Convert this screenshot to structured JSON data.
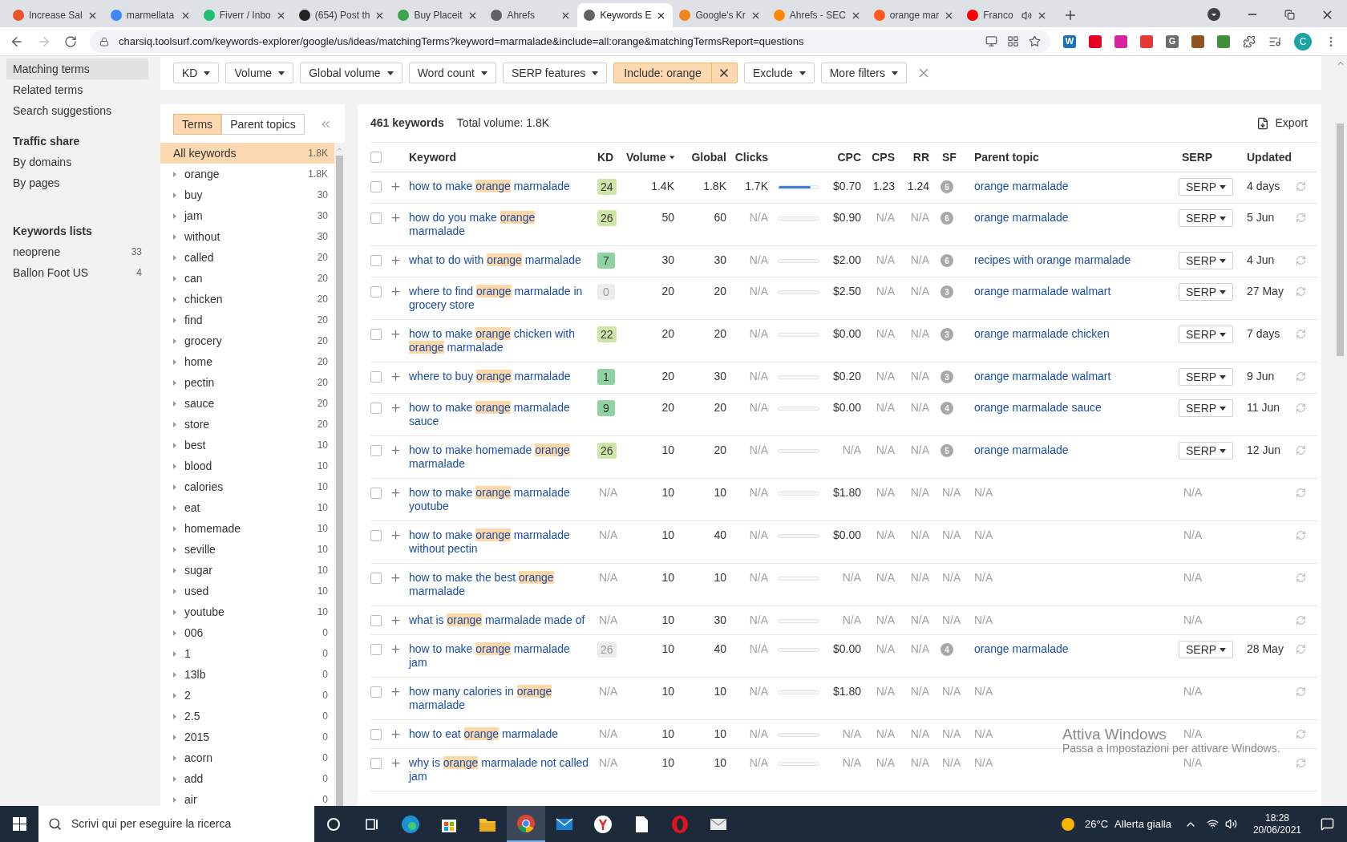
{
  "browser": {
    "tabs": [
      {
        "title": "Increase Sal",
        "color": "#e8542a",
        "selected": false,
        "audio": false
      },
      {
        "title": "marmellata",
        "color": "#4285f4",
        "selected": false,
        "audio": false
      },
      {
        "title": "Fiverr / Inbo",
        "color": "#1dbf73",
        "selected": false,
        "audio": false
      },
      {
        "title": "(654) Post th",
        "color": "#222222",
        "selected": false,
        "audio": false
      },
      {
        "title": "Buy Placeit",
        "color": "#3ca34a",
        "selected": false,
        "audio": false
      },
      {
        "title": "Ahrefs",
        "color": "#5f6368",
        "selected": false,
        "audio": false
      },
      {
        "title": "Keywords E",
        "color": "#5f6368",
        "selected": true,
        "audio": false
      },
      {
        "title": "Google's Kr",
        "color": "#f58220",
        "selected": false,
        "audio": false
      },
      {
        "title": "Ahrefs - SEC",
        "color": "#ff8800",
        "selected": false,
        "audio": false
      },
      {
        "title": "orange mar",
        "color": "#ff5a1f",
        "selected": false,
        "audio": false
      },
      {
        "title": "Franco",
        "color": "#ff0000",
        "selected": false,
        "audio": true
      }
    ],
    "url": "charsiq.toolsurf.com/keywords-explorer/google/us/ideas/matchingTerms?keyword=marmalade&include=all:orange&matchingTermsReport=questions",
    "extensions": [
      {
        "label": "W",
        "color": "#1d6fb8"
      },
      {
        "color": "#e60023"
      },
      {
        "color": "#d6249f"
      },
      {
        "color": "#e53935"
      },
      {
        "label": "G",
        "color": "#6b6b6b"
      },
      {
        "color": "#8d5524"
      },
      {
        "color": "#3f8f3f"
      }
    ],
    "profile": {
      "initial": "C",
      "color": "#1ca3a3"
    }
  },
  "sidebar": {
    "sections": [
      {
        "items": [
          {
            "label": "Matching terms",
            "selected": true
          },
          {
            "label": "Related terms",
            "selected": false
          },
          {
            "label": "Search suggestions",
            "selected": false
          }
        ]
      },
      {
        "heading": "Traffic share",
        "items": [
          {
            "label": "By domains",
            "selected": false
          },
          {
            "label": "By pages",
            "selected": false
          }
        ]
      },
      {
        "heading": "Keywords lists",
        "items": [
          {
            "label": "neoprene",
            "count": "33",
            "selected": false
          },
          {
            "label": "Ballon Foot US",
            "count": "4",
            "selected": false
          }
        ]
      }
    ]
  },
  "filters": [
    {
      "label": "KD",
      "active": false
    },
    {
      "label": "Volume",
      "active": false
    },
    {
      "label": "Global volume",
      "active": false
    },
    {
      "label": "Word count",
      "active": false
    },
    {
      "label": "SERP features",
      "active": false
    },
    {
      "label": "Include: orange",
      "active": true
    },
    {
      "label": "Exclude",
      "active": false
    },
    {
      "label": "More filters",
      "active": false
    }
  ],
  "terms_panel": {
    "tabs": [
      {
        "label": "Terms",
        "selected": true
      },
      {
        "label": "Parent topics",
        "selected": false
      }
    ],
    "items": [
      {
        "label": "All keywords",
        "count": "1.8K",
        "selected": true,
        "expandable": false
      },
      {
        "label": "orange",
        "count": "1.8K",
        "selected": false,
        "expandable": true
      },
      {
        "label": "buy",
        "count": "30",
        "selected": false,
        "expandable": true
      },
      {
        "label": "jam",
        "count": "30",
        "selected": false,
        "expandable": true
      },
      {
        "label": "without",
        "count": "30",
        "selected": false,
        "expandable": true
      },
      {
        "label": "called",
        "count": "20",
        "selected": false,
        "expandable": true
      },
      {
        "label": "can",
        "count": "20",
        "selected": false,
        "expandable": true
      },
      {
        "label": "chicken",
        "count": "20",
        "selected": false,
        "expandable": true
      },
      {
        "label": "find",
        "count": "20",
        "selected": false,
        "expandable": true
      },
      {
        "label": "grocery",
        "count": "20",
        "selected": false,
        "expandable": true
      },
      {
        "label": "home",
        "count": "20",
        "selected": false,
        "expandable": true
      },
      {
        "label": "pectin",
        "count": "20",
        "selected": false,
        "expandable": true
      },
      {
        "label": "sauce",
        "count": "20",
        "selected": false,
        "expandable": true
      },
      {
        "label": "store",
        "count": "20",
        "selected": false,
        "expandable": true
      },
      {
        "label": "best",
        "count": "10",
        "selected": false,
        "expandable": true
      },
      {
        "label": "blood",
        "count": "10",
        "selected": false,
        "expandable": true
      },
      {
        "label": "calories",
        "count": "10",
        "selected": false,
        "expandable": true
      },
      {
        "label": "eat",
        "count": "10",
        "selected": false,
        "expandable": true
      },
      {
        "label": "homemade",
        "count": "10",
        "selected": false,
        "expandable": true
      },
      {
        "label": "seville",
        "count": "10",
        "selected": false,
        "expandable": true
      },
      {
        "label": "sugar",
        "count": "10",
        "selected": false,
        "expandable": true
      },
      {
        "label": "used",
        "count": "10",
        "selected": false,
        "expandable": true
      },
      {
        "label": "youtube",
        "count": "10",
        "selected": false,
        "expandable": true
      },
      {
        "label": "006",
        "count": "0",
        "selected": false,
        "expandable": true
      },
      {
        "label": "1",
        "count": "0",
        "selected": false,
        "expandable": true
      },
      {
        "label": "13lb",
        "count": "0",
        "selected": false,
        "expandable": true
      },
      {
        "label": "2",
        "count": "0",
        "selected": false,
        "expandable": true
      },
      {
        "label": "2.5",
        "count": "0",
        "selected": false,
        "expandable": true
      },
      {
        "label": "2015",
        "count": "0",
        "selected": false,
        "expandable": true
      },
      {
        "label": "acorn",
        "count": "0",
        "selected": false,
        "expandable": true
      },
      {
        "label": "add",
        "count": "0",
        "selected": false,
        "expandable": true
      },
      {
        "label": "air",
        "count": "0",
        "selected": false,
        "expandable": true
      }
    ]
  },
  "results": {
    "count": "461 keywords",
    "total_volume": "Total volume: 1.8K",
    "export": "Export",
    "columns": [
      "Keyword",
      "KD",
      "Volume",
      "Global",
      "Clicks",
      "CPC",
      "CPS",
      "RR",
      "SF",
      "Parent topic",
      "SERP",
      "Updated"
    ],
    "select_all_checked": false,
    "rows": [
      {
        "checked": false,
        "keyword": [
          {
            "text": "how to make ",
            "highlight": false
          },
          {
            "text": "orange",
            "highlight": true
          },
          {
            "text": " marmalade",
            "highlight": false
          }
        ],
        "kd": {
          "text": "24",
          "kind": "score",
          "color": "#cfe5a8"
        },
        "volume": "1.4K",
        "global": "1.8K",
        "clicks": {
          "text": "1.7K",
          "muted": false
        },
        "level": 0.8,
        "cpc": {
          "text": "$0.70",
          "muted": false
        },
        "cps": {
          "text": "1.23",
          "muted": false
        },
        "rr": {
          "text": "1.24",
          "muted": false
        },
        "sf": {
          "text": "5",
          "kind": "count"
        },
        "parent": {
          "text": "orange marmalade",
          "kind": "link"
        },
        "serp": {
          "text": "SERP",
          "kind": "button"
        },
        "updated": "4 days"
      },
      {
        "checked": false,
        "keyword": [
          {
            "text": "how do you make ",
            "highlight": false
          },
          {
            "text": "orange",
            "highlight": true
          },
          {
            "text": " marmalade",
            "highlight": false
          }
        ],
        "kd": {
          "text": "26",
          "kind": "score",
          "color": "#cfe5a8"
        },
        "volume": "50",
        "global": "60",
        "clicks": {
          "text": "N/A",
          "muted": true
        },
        "level": 0,
        "cpc": {
          "text": "$0.90",
          "muted": false
        },
        "cps": {
          "text": "N/A",
          "muted": true
        },
        "rr": {
          "text": "N/A",
          "muted": true
        },
        "sf": {
          "text": "6",
          "kind": "count"
        },
        "parent": {
          "text": "orange marmalade",
          "kind": "link"
        },
        "serp": {
          "text": "SERP",
          "kind": "button"
        },
        "updated": "5 Jun"
      },
      {
        "checked": false,
        "keyword": [
          {
            "text": "what to do with ",
            "highlight": false
          },
          {
            "text": "orange",
            "highlight": true
          },
          {
            "text": " marmalade",
            "highlight": false
          }
        ],
        "kd": {
          "text": "7",
          "kind": "score",
          "color": "#8fd3a3"
        },
        "volume": "30",
        "global": "30",
        "clicks": {
          "text": "N/A",
          "muted": true
        },
        "level": 0,
        "cpc": {
          "text": "$2.00",
          "muted": false
        },
        "cps": {
          "text": "N/A",
          "muted": true
        },
        "rr": {
          "text": "N/A",
          "muted": true
        },
        "sf": {
          "text": "6",
          "kind": "count"
        },
        "parent": {
          "text": "recipes with orange marmalade",
          "kind": "link"
        },
        "serp": {
          "text": "SERP",
          "kind": "button"
        },
        "updated": "4 Jun"
      },
      {
        "checked": false,
        "keyword": [
          {
            "text": "where to find ",
            "highlight": false
          },
          {
            "text": "orange",
            "highlight": true
          },
          {
            "text": " marmalade in grocery store",
            "highlight": false
          }
        ],
        "kd": {
          "text": "0",
          "kind": "stale",
          "color": "#ececec"
        },
        "volume": "20",
        "global": "20",
        "clicks": {
          "text": "N/A",
          "muted": true
        },
        "level": 0,
        "cpc": {
          "text": "$2.50",
          "muted": false
        },
        "cps": {
          "text": "N/A",
          "muted": true
        },
        "rr": {
          "text": "N/A",
          "muted": true
        },
        "sf": {
          "text": "3",
          "kind": "count"
        },
        "parent": {
          "text": "orange marmalade walmart",
          "kind": "link"
        },
        "serp": {
          "text": "SERP",
          "kind": "button"
        },
        "updated": "27 May"
      },
      {
        "checked": false,
        "keyword": [
          {
            "text": "how to make ",
            "highlight": false
          },
          {
            "text": "orange",
            "highlight": true
          },
          {
            "text": " chicken with ",
            "highlight": false
          },
          {
            "text": "orange",
            "highlight": true
          },
          {
            "text": " marmalade",
            "highlight": false
          }
        ],
        "kd": {
          "text": "22",
          "kind": "score",
          "color": "#cfe5a8"
        },
        "volume": "20",
        "global": "20",
        "clicks": {
          "text": "N/A",
          "muted": true
        },
        "level": 0,
        "cpc": {
          "text": "$0.00",
          "muted": false
        },
        "cps": {
          "text": "N/A",
          "muted": true
        },
        "rr": {
          "text": "N/A",
          "muted": true
        },
        "sf": {
          "text": "3",
          "kind": "count"
        },
        "parent": {
          "text": "orange marmalade chicken",
          "kind": "link"
        },
        "serp": {
          "text": "SERP",
          "kind": "button"
        },
        "updated": "7 days"
      },
      {
        "checked": false,
        "keyword": [
          {
            "text": "where to buy ",
            "highlight": false
          },
          {
            "text": "orange",
            "highlight": true
          },
          {
            "text": " marmalade",
            "highlight": false
          }
        ],
        "kd": {
          "text": "1",
          "kind": "score",
          "color": "#8fd3a3"
        },
        "volume": "20",
        "global": "30",
        "clicks": {
          "text": "N/A",
          "muted": true
        },
        "level": 0,
        "cpc": {
          "text": "$0.20",
          "muted": false
        },
        "cps": {
          "text": "N/A",
          "muted": true
        },
        "rr": {
          "text": "N/A",
          "muted": true
        },
        "sf": {
          "text": "3",
          "kind": "count"
        },
        "parent": {
          "text": "orange marmalade walmart",
          "kind": "link"
        },
        "serp": {
          "text": "SERP",
          "kind": "button"
        },
        "updated": "9 Jun"
      },
      {
        "checked": false,
        "keyword": [
          {
            "text": "how to make ",
            "highlight": false
          },
          {
            "text": "orange",
            "highlight": true
          },
          {
            "text": " marmalade sauce",
            "highlight": false
          }
        ],
        "kd": {
          "text": "9",
          "kind": "score",
          "color": "#8fd3a3"
        },
        "volume": "20",
        "global": "20",
        "clicks": {
          "text": "N/A",
          "muted": true
        },
        "level": 0,
        "cpc": {
          "text": "$0.00",
          "muted": false
        },
        "cps": {
          "text": "N/A",
          "muted": true
        },
        "rr": {
          "text": "N/A",
          "muted": true
        },
        "sf": {
          "text": "4",
          "kind": "count"
        },
        "parent": {
          "text": "orange marmalade sauce",
          "kind": "link"
        },
        "serp": {
          "text": "SERP",
          "kind": "button"
        },
        "updated": "11 Jun"
      },
      {
        "checked": false,
        "keyword": [
          {
            "text": "how to make homemade ",
            "highlight": false
          },
          {
            "text": "orange",
            "highlight": true
          },
          {
            "text": " marmalade",
            "highlight": false
          }
        ],
        "kd": {
          "text": "26",
          "kind": "score",
          "color": "#cfe5a8"
        },
        "volume": "10",
        "global": "20",
        "clicks": {
          "text": "N/A",
          "muted": true
        },
        "level": 0,
        "cpc": {
          "text": "N/A",
          "muted": true
        },
        "cps": {
          "text": "N/A",
          "muted": true
        },
        "rr": {
          "text": "N/A",
          "muted": true
        },
        "sf": {
          "text": "5",
          "kind": "count"
        },
        "parent": {
          "text": "orange marmalade",
          "kind": "link"
        },
        "serp": {
          "text": "SERP",
          "kind": "button"
        },
        "updated": "12 Jun"
      },
      {
        "checked": false,
        "keyword": [
          {
            "text": "how to make ",
            "highlight": false
          },
          {
            "text": "orange",
            "highlight": true
          },
          {
            "text": " marmalade youtube",
            "highlight": false
          }
        ],
        "kd": {
          "text": "N/A",
          "kind": "none"
        },
        "volume": "10",
        "global": "10",
        "clicks": {
          "text": "N/A",
          "muted": true
        },
        "level": 0,
        "cpc": {
          "text": "$1.80",
          "muted": false
        },
        "cps": {
          "text": "N/A",
          "muted": true
        },
        "rr": {
          "text": "N/A",
          "muted": true
        },
        "sf": {
          "text": "N/A",
          "kind": "none"
        },
        "parent": {
          "text": "N/A",
          "kind": "none"
        },
        "serp": {
          "text": "N/A",
          "kind": "none"
        }
      },
      {
        "checked": false,
        "keyword": [
          {
            "text": "how to make ",
            "highlight": false
          },
          {
            "text": "orange",
            "highlight": true
          },
          {
            "text": " marmalade without pectin",
            "highlight": false
          }
        ],
        "kd": {
          "text": "N/A",
          "kind": "none"
        },
        "volume": "10",
        "global": "40",
        "clicks": {
          "text": "N/A",
          "muted": true
        },
        "level": 0,
        "cpc": {
          "text": "$0.00",
          "muted": false
        },
        "cps": {
          "text": "N/A",
          "muted": true
        },
        "rr": {
          "text": "N/A",
          "muted": true
        },
        "sf": {
          "text": "N/A",
          "kind": "none"
        },
        "parent": {
          "text": "N/A",
          "kind": "none"
        },
        "serp": {
          "text": "N/A",
          "kind": "none"
        }
      },
      {
        "checked": false,
        "keyword": [
          {
            "text": "how to make the best ",
            "highlight": false
          },
          {
            "text": "orange",
            "highlight": true
          },
          {
            "text": " marmalade",
            "highlight": false
          }
        ],
        "kd": {
          "text": "N/A",
          "kind": "none"
        },
        "volume": "10",
        "global": "10",
        "clicks": {
          "text": "N/A",
          "muted": true
        },
        "level": 0,
        "cpc": {
          "text": "N/A",
          "muted": true
        },
        "cps": {
          "text": "N/A",
          "muted": true
        },
        "rr": {
          "text": "N/A",
          "muted": true
        },
        "sf": {
          "text": "N/A",
          "kind": "none"
        },
        "parent": {
          "text": "N/A",
          "kind": "none"
        },
        "serp": {
          "text": "N/A",
          "kind": "none"
        }
      },
      {
        "checked": false,
        "keyword": [
          {
            "text": "what is ",
            "highlight": false
          },
          {
            "text": "orange",
            "highlight": true
          },
          {
            "text": " marmalade made of",
            "highlight": false
          }
        ],
        "kd": {
          "text": "N/A",
          "kind": "none"
        },
        "volume": "10",
        "global": "30",
        "clicks": {
          "text": "N/A",
          "muted": true
        },
        "level": 0,
        "cpc": {
          "text": "N/A",
          "muted": true
        },
        "cps": {
          "text": "N/A",
          "muted": true
        },
        "rr": {
          "text": "N/A",
          "muted": true
        },
        "sf": {
          "text": "N/A",
          "kind": "none"
        },
        "parent": {
          "text": "N/A",
          "kind": "none"
        },
        "serp": {
          "text": "N/A",
          "kind": "none"
        }
      },
      {
        "checked": false,
        "keyword": [
          {
            "text": "how to make ",
            "highlight": false
          },
          {
            "text": "orange",
            "highlight": true
          },
          {
            "text": " marmalade jam",
            "highlight": false
          }
        ],
        "kd": {
          "text": "26",
          "kind": "stale",
          "color": "#ececec"
        },
        "volume": "10",
        "global": "40",
        "clicks": {
          "text": "N/A",
          "muted": true
        },
        "level": 0,
        "cpc": {
          "text": "$0.00",
          "muted": false
        },
        "cps": {
          "text": "N/A",
          "muted": true
        },
        "rr": {
          "text": "N/A",
          "muted": true
        },
        "sf": {
          "text": "4",
          "kind": "count"
        },
        "parent": {
          "text": "orange marmalade",
          "kind": "link"
        },
        "serp": {
          "text": "SERP",
          "kind": "button"
        },
        "updated": "28 May"
      },
      {
        "checked": false,
        "keyword": [
          {
            "text": "how many calories in ",
            "highlight": false
          },
          {
            "text": "orange",
            "highlight": true
          },
          {
            "text": " marmalade",
            "highlight": false
          }
        ],
        "kd": {
          "text": "N/A",
          "kind": "none"
        },
        "volume": "10",
        "global": "10",
        "clicks": {
          "text": "N/A",
          "muted": true
        },
        "level": 0,
        "cpc": {
          "text": "$1.80",
          "muted": false
        },
        "cps": {
          "text": "N/A",
          "muted": true
        },
        "rr": {
          "text": "N/A",
          "muted": true
        },
        "sf": {
          "text": "N/A",
          "kind": "none"
        },
        "parent": {
          "text": "N/A",
          "kind": "none"
        },
        "serp": {
          "text": "N/A",
          "kind": "none"
        }
      },
      {
        "checked": false,
        "keyword": [
          {
            "text": "how to eat ",
            "highlight": false
          },
          {
            "text": "orange",
            "highlight": true
          },
          {
            "text": " marmalade",
            "highlight": false
          }
        ],
        "kd": {
          "text": "N/A",
          "kind": "none"
        },
        "volume": "10",
        "global": "10",
        "clicks": {
          "text": "N/A",
          "muted": true
        },
        "level": 0,
        "cpc": {
          "text": "N/A",
          "muted": true
        },
        "cps": {
          "text": "N/A",
          "muted": true
        },
        "rr": {
          "text": "N/A",
          "muted": true
        },
        "sf": {
          "text": "N/A",
          "kind": "none"
        },
        "parent": {
          "text": "N/A",
          "kind": "none"
        },
        "serp": {
          "text": "N/A",
          "kind": "none"
        }
      },
      {
        "checked": false,
        "keyword": [
          {
            "text": "why is ",
            "highlight": false
          },
          {
            "text": "orange",
            "highlight": true
          },
          {
            "text": " marmalade not called jam",
            "highlight": false
          }
        ],
        "kd": {
          "text": "N/A",
          "kind": "none"
        },
        "volume": "10",
        "global": "10",
        "clicks": {
          "text": "N/A",
          "muted": true
        },
        "level": 0,
        "cpc": {
          "text": "N/A",
          "muted": true
        },
        "cps": {
          "text": "N/A",
          "muted": true
        },
        "rr": {
          "text": "N/A",
          "muted": true
        },
        "sf": {
          "text": "N/A",
          "kind": "none"
        },
        "parent": {
          "text": "N/A",
          "kind": "none"
        },
        "serp": {
          "text": "N/A",
          "kind": "none"
        }
      }
    ]
  },
  "activation_notice": {
    "title": "Attiva Windows",
    "text": "Passa a Impostazioni per attivare Windows."
  },
  "taskbar": {
    "search_placeholder": "Scrivi qui per eseguire la ricerca",
    "apps": [
      {
        "kind": "cortana",
        "selected": false
      },
      {
        "kind": "taskview",
        "selected": false
      },
      {
        "kind": "edge",
        "selected": false
      },
      {
        "kind": "store",
        "selected": false
      },
      {
        "kind": "explorer",
        "selected": false
      },
      {
        "kind": "chrome",
        "selected": true
      },
      {
        "kind": "mail",
        "selected": false
      },
      {
        "kind": "yandex",
        "selected": false
      },
      {
        "kind": "file",
        "selected": false
      },
      {
        "kind": "opera",
        "selected": false
      },
      {
        "kind": "envelope",
        "selected": false
      }
    ],
    "temperature": "26°C",
    "weather": "Allerta gialla",
    "time": "18:28",
    "date": "20/06/2021"
  }
}
